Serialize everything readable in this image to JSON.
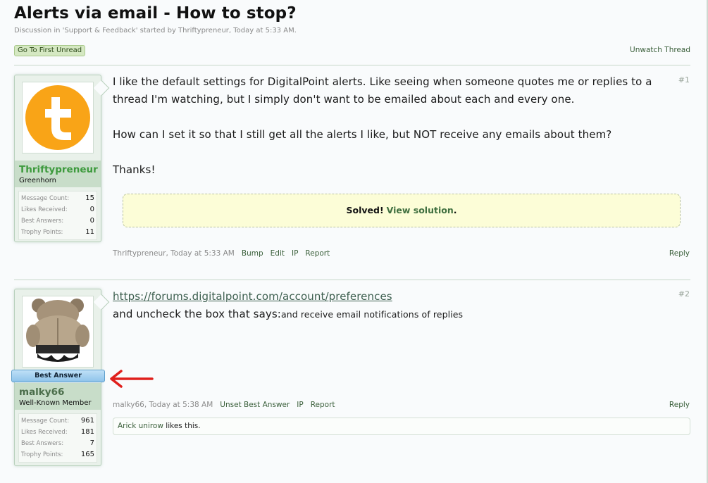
{
  "thread": {
    "title": "Alerts via email - How to stop?",
    "meta": "Discussion in 'Support & Feedback' started by Thriftypreneur, Today at 5:33 AM.",
    "first_unread": "Go To First Unread",
    "unwatch": "Unwatch Thread"
  },
  "posts": [
    {
      "number": "#1",
      "user": {
        "name": "Thriftypreneur",
        "title": "Greenhorn",
        "avatar_icon": "t-letter-icon",
        "stats": [
          {
            "label": "Message Count:",
            "value": "15"
          },
          {
            "label": "Likes Received:",
            "value": "0"
          },
          {
            "label": "Best Answers:",
            "value": "0"
          },
          {
            "label": "Trophy Points:",
            "value": "11"
          }
        ]
      },
      "paragraphs": [
        "I like the default settings for DigitalPoint alerts. Like seeing when someone quotes me or replies to a",
        "thread I'm watching, but I simply don't want to be emailed about each and every one.",
        "How can I set it so that I still get all the alerts I like, but NOT receive any emails about them?",
        "Thanks!"
      ],
      "solved": {
        "label": "Solved!",
        "link": "View solution",
        "suffix": "."
      },
      "footer": {
        "author_time": "Thriftypreneur, Today at 5:33 AM",
        "actions": [
          "Bump",
          "Edit",
          "IP",
          "Report"
        ],
        "reply": "Reply"
      }
    },
    {
      "number": "#2",
      "user": {
        "name": "malky66",
        "title": "Well-Known Member",
        "avatar_icon": "teddy-bear-icon",
        "badge": "Best Answer",
        "stats": [
          {
            "label": "Message Count:",
            "value": "961"
          },
          {
            "label": "Likes Received:",
            "value": "181"
          },
          {
            "label": "Best Answers:",
            "value": "7"
          },
          {
            "label": "Trophy Points:",
            "value": "165"
          }
        ]
      },
      "link": "https://forums.digitalpoint.com/account/preferences",
      "line2_main": "and uncheck the box that says:",
      "line2_small": "and receive email notifications of replies",
      "footer": {
        "author_time": "malky66, Today at 5:38 AM",
        "actions": [
          "Unset Best Answer",
          "IP",
          "Report"
        ],
        "reply": "Reply"
      },
      "likes": {
        "users": "Arick unirow",
        "suffix": "likes this."
      }
    }
  ],
  "colors": {
    "username_green": "#3d9a3d",
    "accent_link": "#3a5f3a",
    "annotation_arrow": "#e0201c",
    "best_answer_blue": "#8ec3ea"
  }
}
